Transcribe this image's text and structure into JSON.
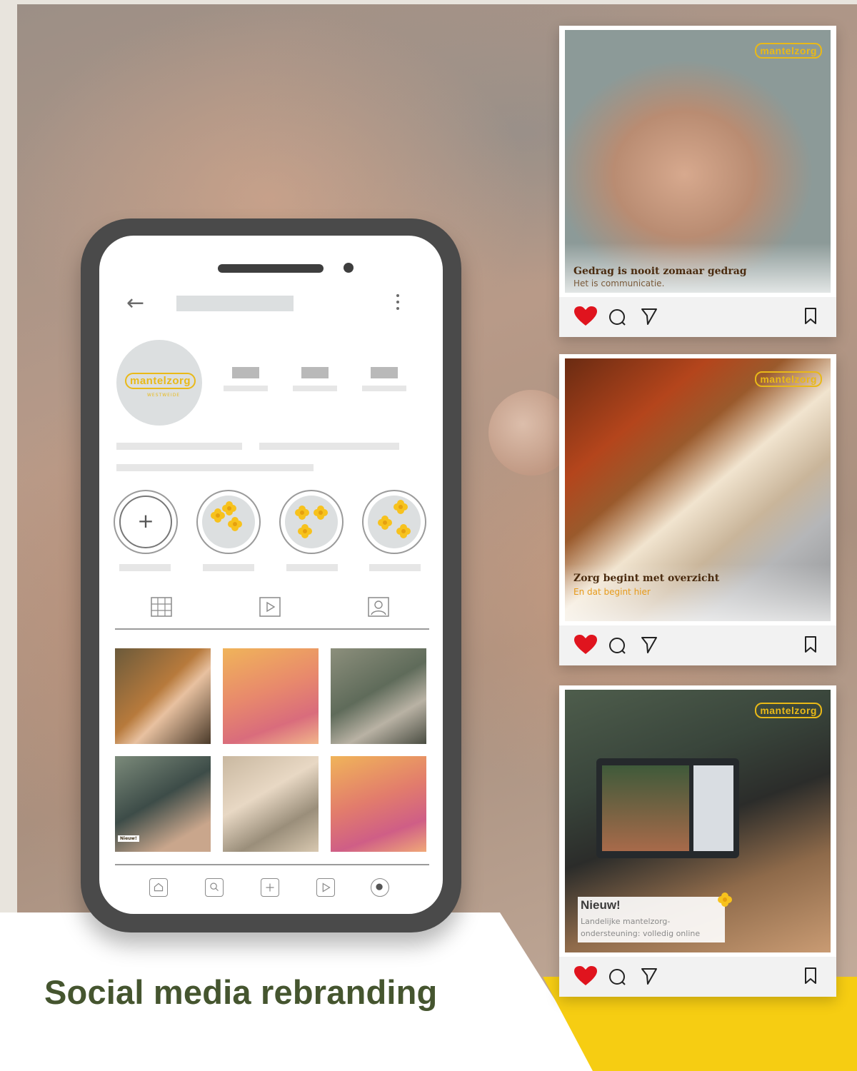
{
  "headline": "Social media rebranding",
  "colors": {
    "brand_yellow": "#f6cd12",
    "headline_green": "#45552f",
    "heart_red": "#e0141e",
    "phone_frame": "#4a4a4a"
  },
  "brand": {
    "logo_text": "mantelzorg",
    "logo_sub": "WESTWEIDE"
  },
  "phone": {
    "back_icon": "arrow-left-icon",
    "menu_icon": "kebab-menu-icon",
    "new_highlight_icon": "plus-icon",
    "tabs": [
      "grid-icon",
      "reels-icon",
      "tagged-icon"
    ],
    "bottom_nav": [
      "home-icon",
      "search-icon",
      "add-icon",
      "reels-icon",
      "profile-icon"
    ],
    "grid_posts": [
      {
        "caption": ""
      },
      {
        "caption": ""
      },
      {
        "caption": ""
      },
      {
        "caption": "Nieuw!"
      },
      {
        "caption": ""
      },
      {
        "caption": ""
      }
    ]
  },
  "cards": [
    {
      "title": "Gedrag is nooit zomaar gedrag",
      "subtitle": "Het is communicatie."
    },
    {
      "title": "Zorg begint met overzicht",
      "subtitle": "En dat begint hier"
    },
    {
      "title": "Nieuw!",
      "subtitle_line1": "Landelijke mantelzorg-",
      "subtitle_line2": "ondersteuning: volledig online"
    }
  ],
  "card_actions": [
    "heart-icon",
    "comment-icon",
    "send-icon",
    "bookmark-icon"
  ]
}
